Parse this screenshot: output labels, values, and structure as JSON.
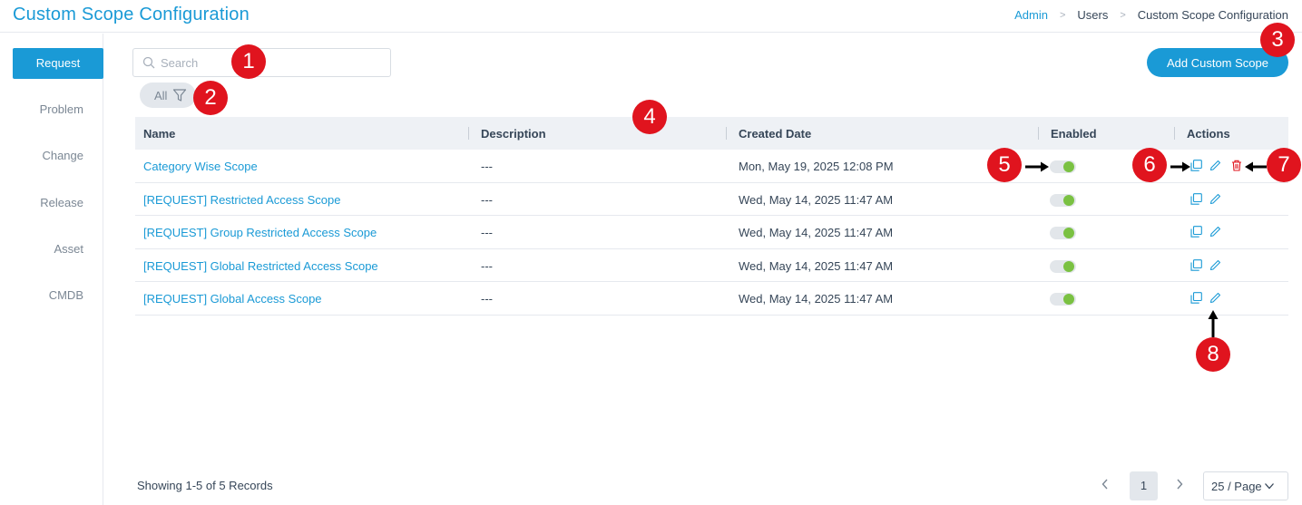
{
  "header": {
    "title": "Custom Scope Configuration",
    "breadcrumb": [
      "Admin",
      "Users",
      "Custom Scope Configuration"
    ]
  },
  "sidebar": {
    "items": [
      {
        "label": "Request",
        "active": true
      },
      {
        "label": "Problem"
      },
      {
        "label": "Change"
      },
      {
        "label": "Release"
      },
      {
        "label": "Asset"
      },
      {
        "label": "CMDB"
      }
    ]
  },
  "search": {
    "placeholder": "Search",
    "value": ""
  },
  "filter": {
    "label": "All"
  },
  "add_button": {
    "label": "Add Custom Scope"
  },
  "table": {
    "columns": [
      "Name",
      "Description",
      "Created Date",
      "Enabled",
      "Actions"
    ],
    "rows": [
      {
        "name": "Category Wise Scope",
        "description": "---",
        "created": "Mon, May 19, 2025 12:08 PM",
        "enabled": true
      },
      {
        "name": "[REQUEST] Restricted Access Scope",
        "description": "---",
        "created": "Wed, May 14, 2025 11:47 AM",
        "enabled": true
      },
      {
        "name": "[REQUEST] Group Restricted Access Scope",
        "description": "---",
        "created": "Wed, May 14, 2025 11:47 AM",
        "enabled": true
      },
      {
        "name": "[REQUEST] Global Restricted Access Scope",
        "description": "---",
        "created": "Wed, May 14, 2025 11:47 AM",
        "enabled": true
      },
      {
        "name": "[REQUEST] Global Access Scope",
        "description": "---",
        "created": "Wed, May 14, 2025 11:47 AM",
        "enabled": true
      }
    ]
  },
  "footer": {
    "records": "Showing 1-5 of 5 Records",
    "page": "1",
    "page_size": "25 / Page"
  },
  "annotations": [
    "1",
    "2",
    "3",
    "4",
    "5",
    "6",
    "7",
    "8"
  ],
  "colors": {
    "accent": "#1a9ad6",
    "toggle_on": "#7ac142",
    "delete": "#e0141e",
    "badge": "#e0141e"
  },
  "icons": [
    "search-icon",
    "filter-icon",
    "clone-icon",
    "edit-icon",
    "delete-icon",
    "chevron-left-icon",
    "chevron-right-icon",
    "chevron-down-icon"
  ]
}
